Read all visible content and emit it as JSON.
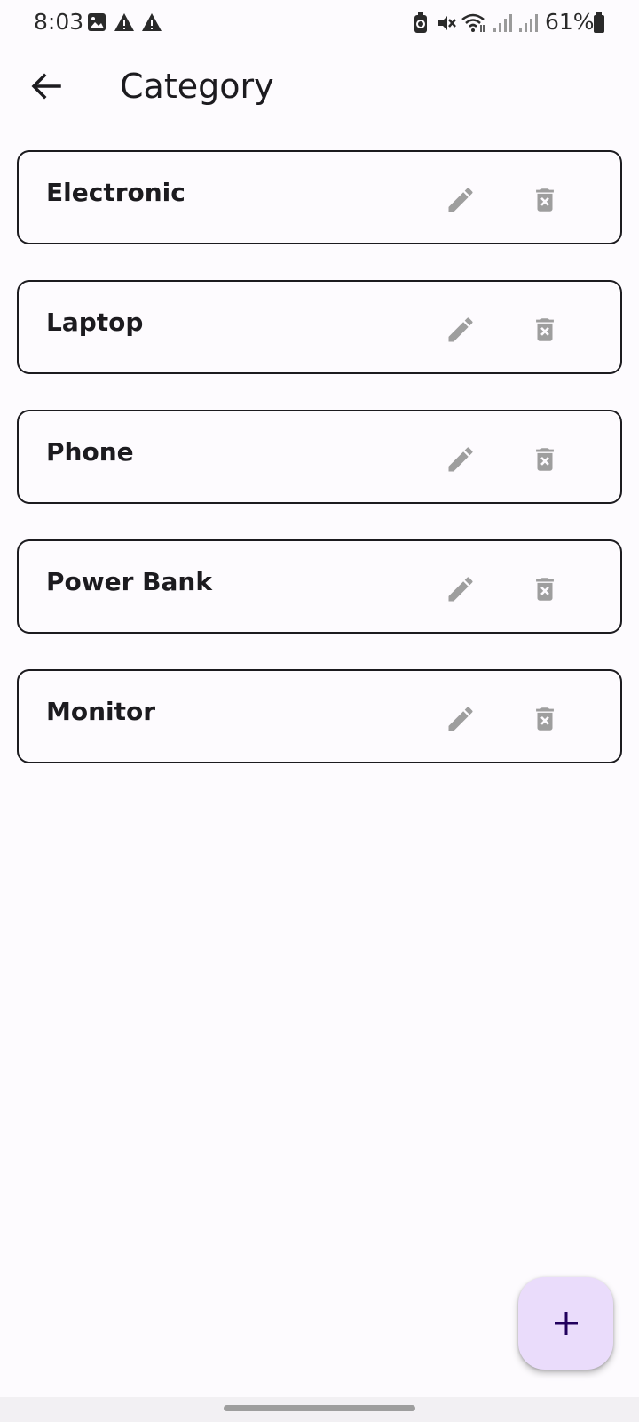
{
  "status_bar": {
    "time": "8:03",
    "battery_percent": "61%",
    "icons": [
      "gallery-icon",
      "warning-icon",
      "warning-icon",
      "battery-saver-icon",
      "mute-icon",
      "wifi-icon",
      "signal-icon",
      "signal-icon",
      "battery-icon"
    ]
  },
  "header": {
    "back_icon": "arrow-left-icon",
    "title": "Category"
  },
  "categories": [
    {
      "label": "Electronic"
    },
    {
      "label": "Laptop"
    },
    {
      "label": "Phone"
    },
    {
      "label": "Power Bank"
    },
    {
      "label": "Monitor"
    }
  ],
  "row_icons": {
    "edit": "pencil-icon",
    "delete": "trash-x-icon"
  },
  "fab": {
    "icon": "plus-icon"
  },
  "colors": {
    "background": "#fdfbfe",
    "text": "#1c1b1f",
    "icon_gray": "#9e9e9e",
    "fab_bg": "#eadcfb",
    "fab_icon": "#21005d"
  }
}
